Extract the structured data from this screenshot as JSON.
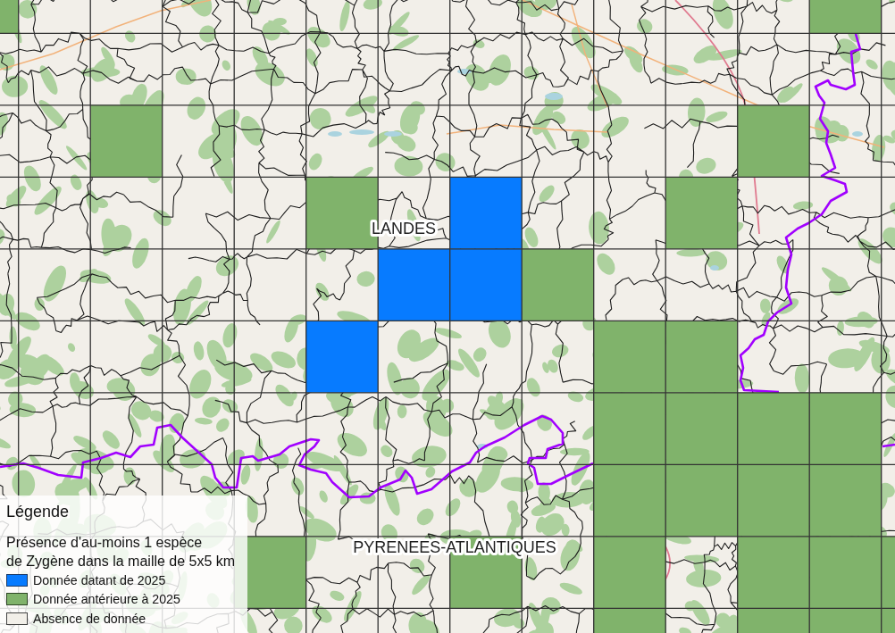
{
  "map": {
    "labels": [
      "LANDES",
      "PYRENEES-ATLANTIQUES"
    ]
  },
  "grid": {
    "rows": [
      [
        {
          "kind": "older"
        },
        {
          "kind": "absent"
        },
        {
          "kind": "absent"
        },
        {
          "kind": "absent"
        },
        {
          "kind": "absent"
        },
        {
          "kind": "absent"
        },
        {
          "kind": "absent"
        },
        {
          "kind": "absent"
        },
        {
          "kind": "absent"
        },
        {
          "kind": "absent"
        },
        {
          "kind": "absent"
        },
        {
          "kind": "absent"
        },
        {
          "kind": "older"
        },
        {
          "kind": "absent"
        }
      ],
      [
        {
          "kind": "absent"
        },
        {
          "kind": "absent"
        },
        {
          "kind": "absent"
        },
        {
          "kind": "absent"
        },
        {
          "kind": "absent"
        },
        {
          "kind": "absent"
        },
        {
          "kind": "absent"
        },
        {
          "kind": "absent"
        },
        {
          "kind": "absent"
        },
        {
          "kind": "absent"
        },
        {
          "kind": "absent"
        },
        {
          "kind": "absent"
        },
        {
          "kind": "absent"
        },
        {
          "kind": "absent"
        }
      ],
      [
        {
          "kind": "absent"
        },
        {
          "kind": "absent"
        },
        {
          "kind": "older"
        },
        {
          "kind": "absent"
        },
        {
          "kind": "absent"
        },
        {
          "kind": "absent"
        },
        {
          "kind": "absent"
        },
        {
          "kind": "absent"
        },
        {
          "kind": "absent"
        },
        {
          "kind": "absent"
        },
        {
          "kind": "absent"
        },
        {
          "kind": "older"
        },
        {
          "kind": "absent"
        },
        {
          "kind": "absent"
        }
      ],
      [
        {
          "kind": "absent"
        },
        {
          "kind": "absent"
        },
        {
          "kind": "absent"
        },
        {
          "kind": "absent"
        },
        {
          "kind": "absent"
        },
        {
          "kind": "older"
        },
        {
          "kind": "absent"
        },
        {
          "kind": "recent"
        },
        {
          "kind": "absent"
        },
        {
          "kind": "absent"
        },
        {
          "kind": "older"
        },
        {
          "kind": "absent"
        },
        {
          "kind": "absent"
        },
        {
          "kind": "absent"
        }
      ],
      [
        {
          "kind": "absent"
        },
        {
          "kind": "absent"
        },
        {
          "kind": "absent"
        },
        {
          "kind": "absent"
        },
        {
          "kind": "absent"
        },
        {
          "kind": "absent"
        },
        {
          "kind": "recent"
        },
        {
          "kind": "recent"
        },
        {
          "kind": "older"
        },
        {
          "kind": "absent"
        },
        {
          "kind": "absent"
        },
        {
          "kind": "absent"
        },
        {
          "kind": "absent"
        },
        {
          "kind": "absent"
        }
      ],
      [
        {
          "kind": "absent"
        },
        {
          "kind": "absent"
        },
        {
          "kind": "absent"
        },
        {
          "kind": "absent"
        },
        {
          "kind": "absent"
        },
        {
          "kind": "recent"
        },
        {
          "kind": "absent"
        },
        {
          "kind": "absent"
        },
        {
          "kind": "absent"
        },
        {
          "kind": "older"
        },
        {
          "kind": "older"
        },
        {
          "kind": "absent"
        },
        {
          "kind": "absent"
        },
        {
          "kind": "absent"
        }
      ],
      [
        {
          "kind": "absent"
        },
        {
          "kind": "absent"
        },
        {
          "kind": "absent"
        },
        {
          "kind": "absent"
        },
        {
          "kind": "absent"
        },
        {
          "kind": "absent"
        },
        {
          "kind": "absent"
        },
        {
          "kind": "absent"
        },
        {
          "kind": "absent"
        },
        {
          "kind": "older"
        },
        {
          "kind": "older"
        },
        {
          "kind": "older"
        },
        {
          "kind": "older"
        },
        {
          "kind": "absent"
        }
      ],
      [
        {
          "kind": "absent"
        },
        {
          "kind": "absent"
        },
        {
          "kind": "absent"
        },
        {
          "kind": "absent"
        },
        {
          "kind": "absent"
        },
        {
          "kind": "absent"
        },
        {
          "kind": "absent"
        },
        {
          "kind": "absent"
        },
        {
          "kind": "absent"
        },
        {
          "kind": "older"
        },
        {
          "kind": "older"
        },
        {
          "kind": "older"
        },
        {
          "kind": "older"
        },
        {
          "kind": "absent"
        }
      ],
      [
        {
          "kind": "absent"
        },
        {
          "kind": "absent"
        },
        {
          "kind": "absent"
        },
        {
          "kind": "absent"
        },
        {
          "kind": "older"
        },
        {
          "kind": "absent"
        },
        {
          "kind": "absent"
        },
        {
          "kind": "older"
        },
        {
          "kind": "absent"
        },
        {
          "kind": "older"
        },
        {
          "kind": "absent"
        },
        {
          "kind": "older"
        },
        {
          "kind": "older"
        },
        {
          "kind": "older"
        }
      ],
      [
        {
          "kind": "absent"
        },
        {
          "kind": "absent"
        },
        {
          "kind": "absent"
        },
        {
          "kind": "absent"
        },
        {
          "kind": "absent"
        },
        {
          "kind": "absent"
        },
        {
          "kind": "absent"
        },
        {
          "kind": "absent"
        },
        {
          "kind": "absent"
        },
        {
          "kind": "older"
        },
        {
          "kind": "absent"
        },
        {
          "kind": "older"
        },
        {
          "kind": "older"
        },
        {
          "kind": "older"
        }
      ]
    ]
  },
  "legend": {
    "title": "Légende",
    "subtitle": "Présence d'au-moins 1 espèce\nde Zygène dans la maille de 5x5 km",
    "items": [
      {
        "kind": "recent",
        "label": "Donnée datant de 2025",
        "color": "#077bff"
      },
      {
        "kind": "older",
        "label": "Donnée antérieure à 2025",
        "color": "#80b36b"
      },
      {
        "kind": "absent",
        "label": "Absence de donnée",
        "color": "#f2efe9"
      }
    ]
  }
}
